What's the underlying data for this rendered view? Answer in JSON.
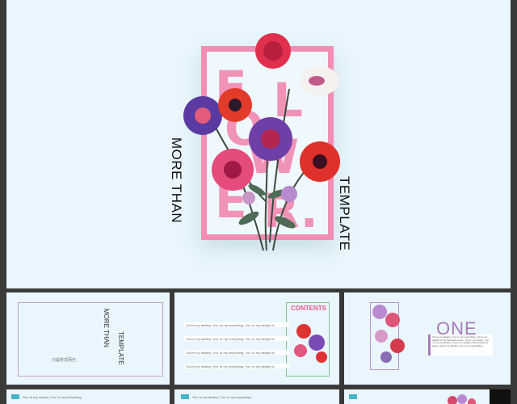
{
  "slide": {
    "letters": [
      "F",
      "L",
      "O",
      "W",
      "E",
      "R."
    ],
    "side_left": "MORE THAN",
    "side_right": "TEMPLATE"
  },
  "thumb1": {
    "vertical_a": "MORE THAN",
    "vertical_b": "TEMPLATE",
    "footer": "只是形式而已"
  },
  "thumb2": {
    "contents_title": "CONTENTS",
    "rows": [
      "You're my destiny. You 're my everything. You 're my delight of..",
      "You're my destiny. You 're my everything. You 're my delight of..",
      "You're my destiny. You 're my everything. You 're my delight of..",
      "You're my destiny. You 're my everything. You 're my delight of.."
    ]
  },
  "thumb3": {
    "title": "ONE",
    "paragraph": "You're my destiny. You 're my everything. You're my delight of the thousand years. You're my destiny. You 're my everything. You're my delight of the thousand years. You're my destiny. You 're my everything."
  },
  "thumb4": {
    "caption": "You 're my destiny. You 're my everything."
  },
  "thumb5": {
    "caption": "You 're my destiny. You 're my everything."
  },
  "colors": {
    "pink": "#f28db4",
    "bg": "#e9f6fd",
    "teal": "#46b5c8",
    "purple": "#a87ab8"
  }
}
